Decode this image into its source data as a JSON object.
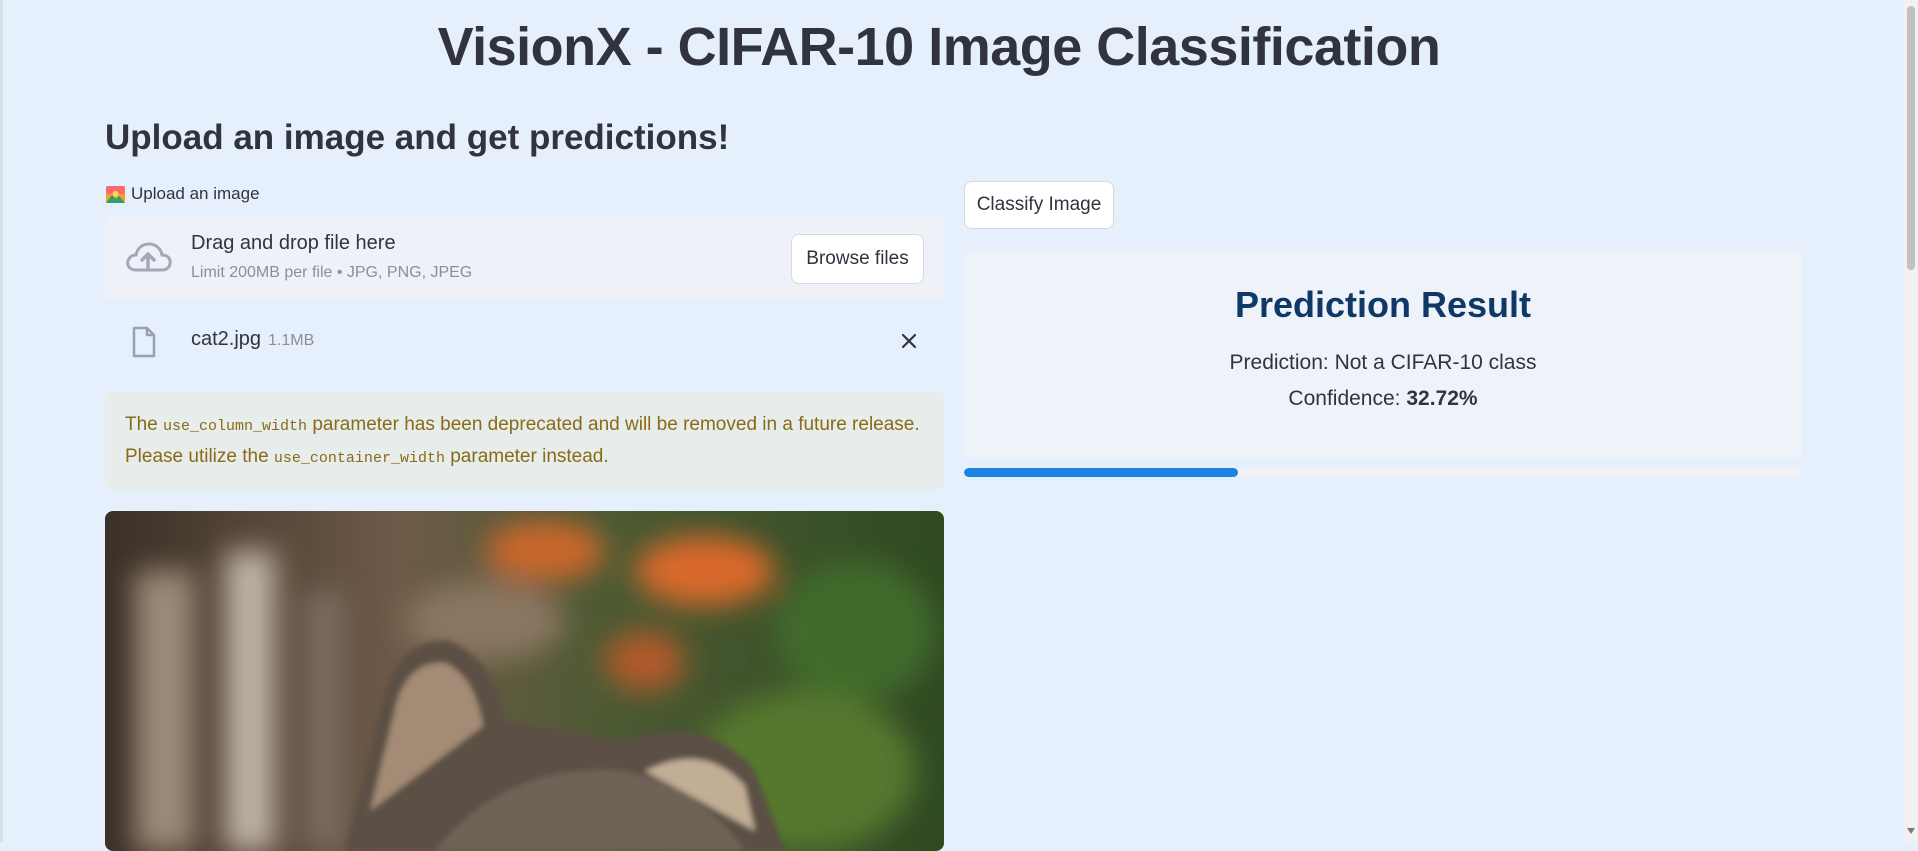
{
  "page": {
    "title": "VisionX - CIFAR-10 Image Classification",
    "subtitle": "Upload an image and get predictions!"
  },
  "uploader": {
    "label": "Upload an image",
    "label_icon": "mountain-sun-icon",
    "drop_title": "Drag and drop file here",
    "drop_limit": "Limit 200MB per file • JPG, PNG, JPEG",
    "browse_label": "Browse files",
    "file": {
      "name": "cat2.jpg",
      "size": "1.1MB"
    }
  },
  "warning": {
    "part1": "The ",
    "code1": "use_column_width",
    "part2": " parameter has been deprecated and will be removed in a future release.",
    "part3": "Please utilize the ",
    "code2": "use_container_width",
    "part4": " parameter instead."
  },
  "classify": {
    "button_label": "Classify Image"
  },
  "result": {
    "title": "Prediction Result",
    "prediction_prefix": "Prediction: ",
    "prediction_value": "Not a CIFAR-10 class",
    "confidence_prefix": "Confidence: ",
    "confidence_value": "32.72%",
    "confidence_fraction": 0.3272
  },
  "colors": {
    "background": "#e6f0fd",
    "accent": "#1c83e1",
    "result_title": "#0f3866",
    "warning_text": "#8a6a16"
  }
}
